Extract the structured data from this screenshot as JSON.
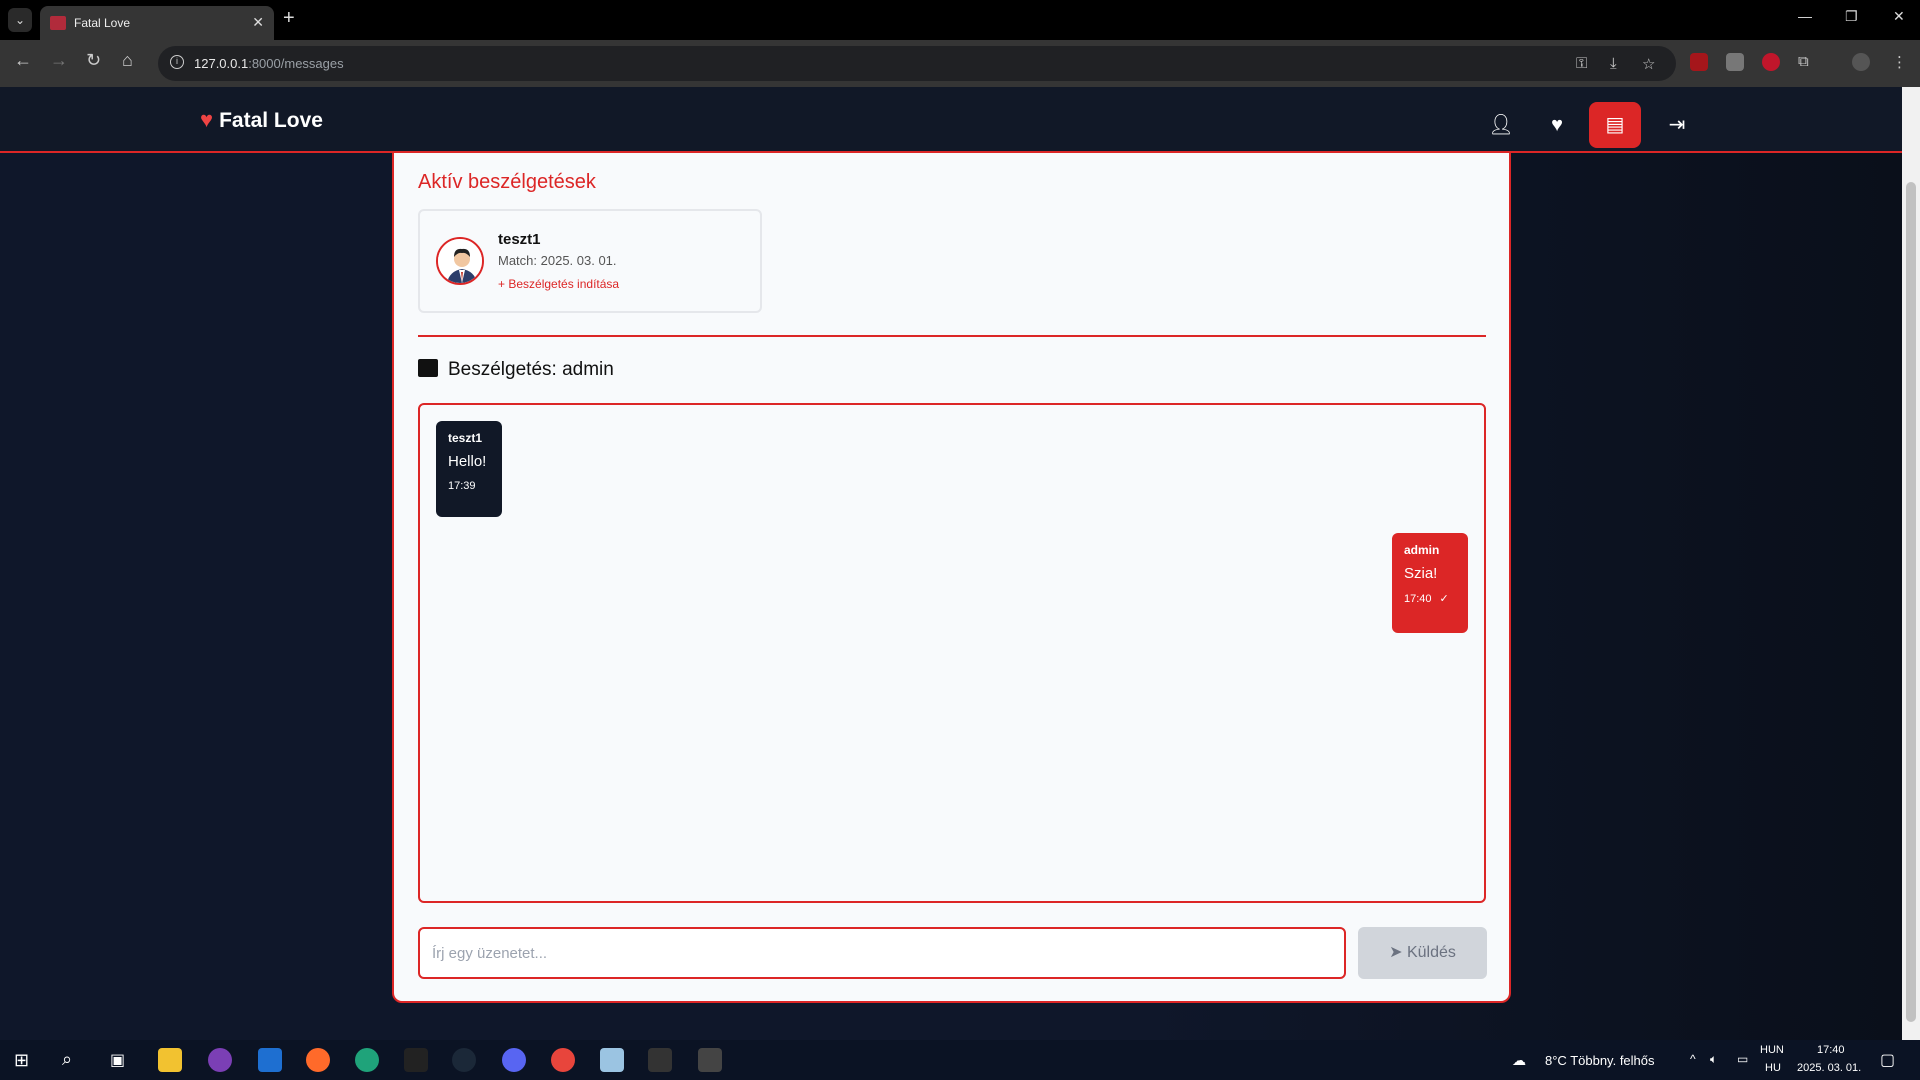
{
  "browser": {
    "tab_title": "Fatal Love",
    "url_host": "127.0.0.1",
    "url_path": ":8000/messages"
  },
  "nav": {
    "brand": "Fatal Love"
  },
  "active_conversations": {
    "title": "Aktív beszélgetések",
    "items": [
      {
        "name": "teszt1",
        "match": "Match: 2025. 03. 01.",
        "start_label": "+ Beszélgetés indítása"
      }
    ]
  },
  "chat": {
    "title": "Beszélgetés: admin",
    "messages": [
      {
        "sender": "teszt1",
        "text": "Hello!",
        "time": "17:39"
      },
      {
        "sender": "admin",
        "text": "Szia!",
        "time": "17:40"
      }
    ],
    "input_placeholder": "Írj egy üzenetet...",
    "send_label": "Küldés"
  },
  "taskbar": {
    "weather": "8°C  Többny. felhős",
    "lang1": "HUN",
    "lang2": "HU",
    "time": "17:40",
    "date": "2025. 03. 01."
  },
  "colors": {
    "accent": "#dc2626",
    "nav_bg": "#111827",
    "card_bg": "#f8fafc"
  }
}
